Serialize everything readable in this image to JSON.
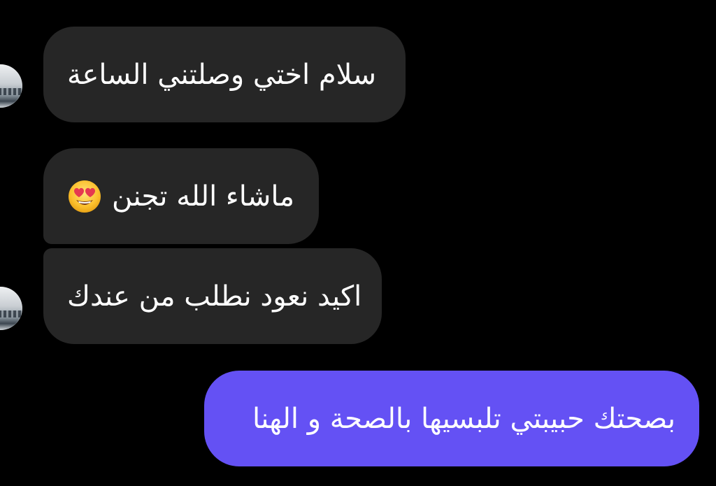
{
  "conversation": {
    "messages": [
      {
        "sender": "contact",
        "text": "سلام اختي وصلتني الساعة"
      },
      {
        "sender": "contact",
        "text": "ماشاء الله تجنن",
        "emoji": "heart-eyes-emoji"
      },
      {
        "sender": "contact",
        "text": "اكيد نعود نطلب من عندك"
      },
      {
        "sender": "me",
        "text": "بصحتك حبيبتي تلبسيها بالصحة و الهنا"
      }
    ]
  },
  "colors": {
    "background": "#000000",
    "incoming_bubble": "#262626",
    "outgoing_bubble": "#6451f4",
    "text": "#ffffff"
  },
  "icons": {
    "contact_avatar": "avatar",
    "emoji": "heart-eyes-emoji"
  }
}
